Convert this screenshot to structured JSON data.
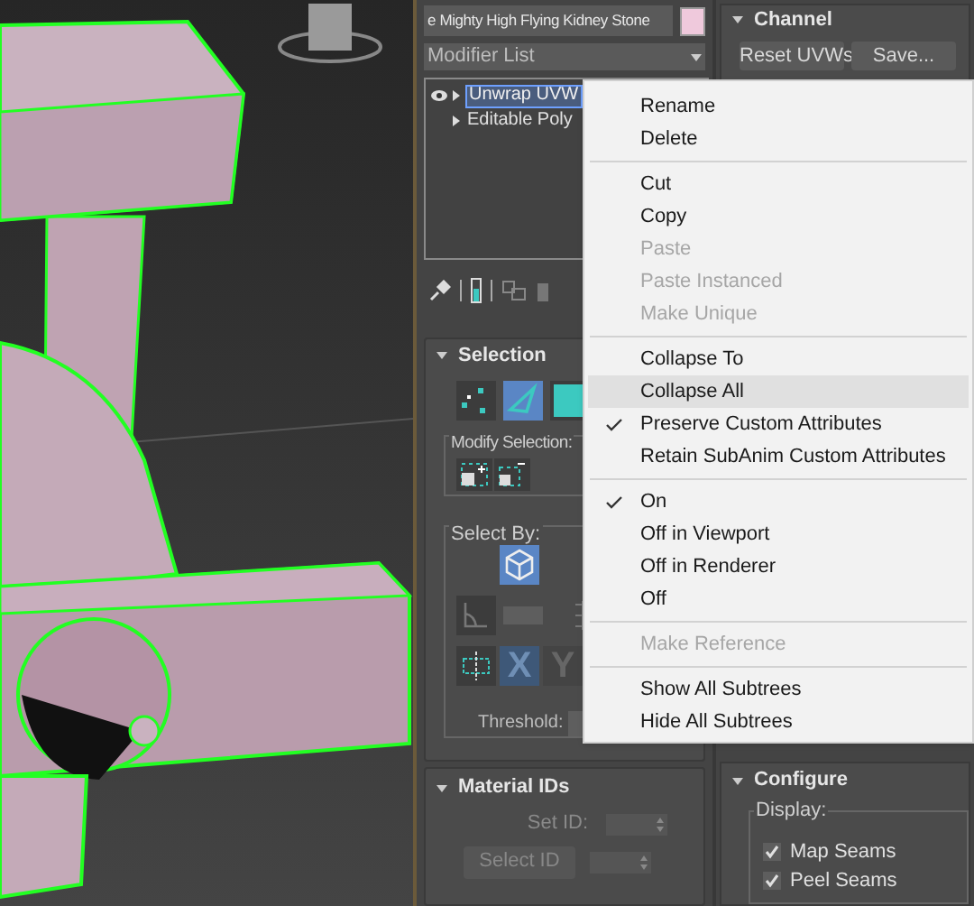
{
  "object_name": {
    "value": "e Mighty High Flying Kidney Stone",
    "color": "#efc9dc"
  },
  "modifier_list": {
    "label": "Modifier List"
  },
  "modifier_stack": [
    {
      "label": "Unwrap UVW",
      "selected": true,
      "eye": true
    },
    {
      "label": "Editable Poly",
      "selected": false,
      "eye": false
    }
  ],
  "selection": {
    "title": "Selection",
    "modes": [
      {
        "kind": "vertex",
        "selected": false
      },
      {
        "kind": "edge",
        "selected": true
      },
      {
        "kind": "face",
        "selected": false
      }
    ],
    "modify_selection_label": "Modify Selection:",
    "select_by_label": "Select By:",
    "axes": [
      {
        "label": "X",
        "selected": true
      },
      {
        "label": "Y",
        "selected": false
      }
    ],
    "threshold_label": "Threshold:"
  },
  "material_ids": {
    "title": "Material IDs",
    "set_id_label": "Set ID:",
    "select_id_button": "Select ID"
  },
  "channel": {
    "title": "Channel",
    "buttons": [
      "Reset UVWs",
      "Save..."
    ]
  },
  "configure": {
    "title": "Configure",
    "display_label": "Display:",
    "checkboxes": [
      {
        "label": "Map Seams",
        "checked": true
      },
      {
        "label": "Peel Seams",
        "checked": true
      }
    ]
  },
  "context_menu": [
    {
      "kind": "item",
      "label": "Rename",
      "disabled": false,
      "checked": false,
      "highlighted": false
    },
    {
      "kind": "item",
      "label": "Delete",
      "disabled": false,
      "checked": false,
      "highlighted": false
    },
    {
      "kind": "separator"
    },
    {
      "kind": "item",
      "label": "Cut",
      "disabled": false,
      "checked": false,
      "highlighted": false
    },
    {
      "kind": "item",
      "label": "Copy",
      "disabled": false,
      "checked": false,
      "highlighted": false
    },
    {
      "kind": "item",
      "label": "Paste",
      "disabled": true,
      "checked": false,
      "highlighted": false
    },
    {
      "kind": "item",
      "label": "Paste Instanced",
      "disabled": true,
      "checked": false,
      "highlighted": false
    },
    {
      "kind": "item",
      "label": "Make Unique",
      "disabled": true,
      "checked": false,
      "highlighted": false
    },
    {
      "kind": "separator"
    },
    {
      "kind": "item",
      "label": "Collapse To",
      "disabled": false,
      "checked": false,
      "highlighted": false
    },
    {
      "kind": "item",
      "label": "Collapse All",
      "disabled": false,
      "checked": false,
      "highlighted": true
    },
    {
      "kind": "item",
      "label": "Preserve Custom Attributes",
      "disabled": false,
      "checked": true,
      "highlighted": false
    },
    {
      "kind": "item",
      "label": "Retain SubAnim Custom Attributes",
      "disabled": false,
      "checked": false,
      "highlighted": false
    },
    {
      "kind": "separator"
    },
    {
      "kind": "item",
      "label": "On",
      "disabled": false,
      "checked": true,
      "highlighted": false
    },
    {
      "kind": "item",
      "label": "Off in Viewport",
      "disabled": false,
      "checked": false,
      "highlighted": false
    },
    {
      "kind": "item",
      "label": "Off in Renderer",
      "disabled": false,
      "checked": false,
      "highlighted": false
    },
    {
      "kind": "item",
      "label": "Off",
      "disabled": false,
      "checked": false,
      "highlighted": false
    },
    {
      "kind": "separator"
    },
    {
      "kind": "item",
      "label": "Make Reference",
      "disabled": true,
      "checked": false,
      "highlighted": false
    },
    {
      "kind": "separator"
    },
    {
      "kind": "item",
      "label": "Show All Subtrees",
      "disabled": false,
      "checked": false,
      "highlighted": false
    },
    {
      "kind": "item",
      "label": "Hide All Subtrees",
      "disabled": false,
      "checked": false,
      "highlighted": false
    }
  ]
}
